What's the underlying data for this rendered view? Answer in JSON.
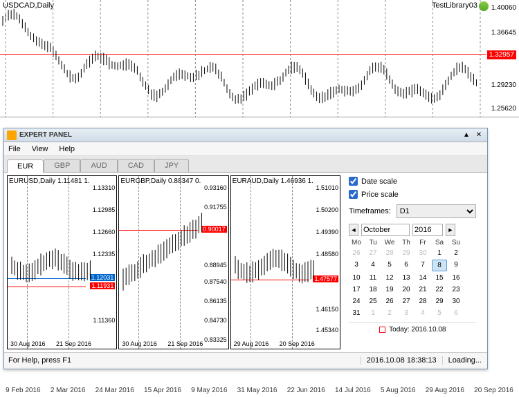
{
  "top": {
    "title": "USDCAD,Daily",
    "library_label": "TestLibrary03",
    "price_line": "1.32957",
    "yticks": [
      "1.40060",
      "1.36645",
      "",
      "1.29230",
      "1.25620"
    ],
    "ytick_pos": [
      6,
      42,
      78,
      118,
      152
    ],
    "xticks": [
      "9 Feb 2016",
      "2 Mar 2016",
      "24 Mar 2016",
      "15 Apr 2016",
      "9 May 2016",
      "31 May 2016",
      "22 Jun 2016",
      "14 Jul 2016",
      "5 Aug 2016",
      "29 Aug 2016",
      "20 Sep 2016"
    ]
  },
  "panel": {
    "title": "EXPERT PANEL",
    "menus": [
      "File",
      "View",
      "Help"
    ],
    "tabs": [
      "EUR",
      "GBP",
      "AUD",
      "CAD",
      "JPY"
    ],
    "active_tab": 0,
    "mini": [
      {
        "title": "EURUSD,Daily  1.11481 1.",
        "yticks": [
          "1.13310",
          "1.12985",
          "1.12660",
          "1.12335",
          "",
          "",
          "",
          "1.11360",
          ""
        ],
        "yt_pos": [
          12,
          44,
          76,
          108,
          140,
          156,
          172,
          204,
          236
        ],
        "blue": "1.12031",
        "blue_y": 148,
        "red": "1.11931",
        "red_y": 160,
        "xlabels": [
          "30 Aug 2016",
          "21 Sep 2016"
        ]
      },
      {
        "title": "EURGBP,Daily  0.88347 0.",
        "yticks": [
          "0.93160",
          "0.91755",
          "",
          "",
          "0.88945",
          "0.87540",
          "0.86135",
          "0.84730",
          "0.83325"
        ],
        "yt_pos": [
          12,
          40,
          68,
          96,
          124,
          148,
          176,
          204,
          232
        ],
        "red": "0.90017",
        "red_y": 78,
        "xlabels": [
          "30 Aug 2016",
          "21 Sep 2016"
        ]
      },
      {
        "title": "EURAUD,Daily  1.46936 1.",
        "yticks": [
          "1.51010",
          "1.50200",
          "1.49390",
          "1.48580",
          "",
          "",
          "1.46150",
          "1.45340"
        ],
        "yt_pos": [
          12,
          44,
          76,
          108,
          140,
          156,
          188,
          218
        ],
        "red": "1.47577",
        "red_y": 150,
        "xlabels": [
          "29 Aug 2016",
          "20 Sep 2016"
        ]
      }
    ],
    "side": {
      "date_scale": "Date scale",
      "price_scale": "Price scale",
      "timeframes_label": "Timeframes:",
      "timeframe_value": "D1",
      "month": "October",
      "year": "2016",
      "day_headers": [
        "Mo",
        "Tu",
        "We",
        "Th",
        "Fr",
        "Sa",
        "Su"
      ],
      "days": [
        {
          "d": "26",
          "o": 1
        },
        {
          "d": "27",
          "o": 1
        },
        {
          "d": "28",
          "o": 1
        },
        {
          "d": "29",
          "o": 1
        },
        {
          "d": "30",
          "o": 1
        },
        {
          "d": "1"
        },
        {
          "d": "2"
        },
        {
          "d": "3"
        },
        {
          "d": "4"
        },
        {
          "d": "5"
        },
        {
          "d": "6"
        },
        {
          "d": "7"
        },
        {
          "d": "8",
          "s": 1
        },
        {
          "d": "9"
        },
        {
          "d": "10"
        },
        {
          "d": "11"
        },
        {
          "d": "12"
        },
        {
          "d": "13"
        },
        {
          "d": "14"
        },
        {
          "d": "15"
        },
        {
          "d": "16"
        },
        {
          "d": "17"
        },
        {
          "d": "18"
        },
        {
          "d": "19"
        },
        {
          "d": "20"
        },
        {
          "d": "21"
        },
        {
          "d": "22"
        },
        {
          "d": "23"
        },
        {
          "d": "24"
        },
        {
          "d": "25"
        },
        {
          "d": "26"
        },
        {
          "d": "27"
        },
        {
          "d": "28"
        },
        {
          "d": "29"
        },
        {
          "d": "30"
        },
        {
          "d": "31"
        },
        {
          "d": "1",
          "o": 1
        },
        {
          "d": "2",
          "o": 1
        },
        {
          "d": "3",
          "o": 1
        },
        {
          "d": "4",
          "o": 1
        },
        {
          "d": "5",
          "o": 1
        },
        {
          "d": "6",
          "o": 1
        }
      ],
      "today_label": "Today: 2016.10.08"
    },
    "status": {
      "help": "For Help, press F1",
      "time": "2016.10.08 18:38:13",
      "loading": "Loading..."
    }
  },
  "chart_data": [
    {
      "type": "line",
      "title": "USDCAD,Daily",
      "ylim": [
        1.256,
        1.401
      ],
      "x_range": [
        "2016-02-09",
        "2016-09-20"
      ],
      "values_approx": [
        1.39,
        1.37,
        1.35,
        1.33,
        1.31,
        1.29,
        1.27,
        1.26,
        1.28,
        1.3,
        1.31,
        1.29,
        1.3,
        1.31,
        1.3,
        1.31,
        1.32,
        1.31,
        1.33
      ],
      "hline": 1.32957,
      "xlabel": "",
      "ylabel": ""
    },
    {
      "type": "bar",
      "title": "EURUSD,Daily",
      "ylim": [
        1.11036,
        1.1331
      ],
      "hline_blue": 1.12031,
      "hline_red": 1.11931,
      "categories": [
        "30 Aug 2016",
        "21 Sep 2016"
      ],
      "values": []
    },
    {
      "type": "bar",
      "title": "EURGBP,Daily",
      "ylim": [
        0.83325,
        0.9316
      ],
      "hline_red": 0.90017,
      "categories": [
        "30 Aug 2016",
        "21 Sep 2016"
      ],
      "values": []
    },
    {
      "type": "bar",
      "title": "EURAUD,Daily",
      "ylim": [
        1.4534,
        1.5101
      ],
      "hline_red": 1.47577,
      "categories": [
        "29 Aug 2016",
        "20 Sep 2016"
      ],
      "values": []
    }
  ]
}
